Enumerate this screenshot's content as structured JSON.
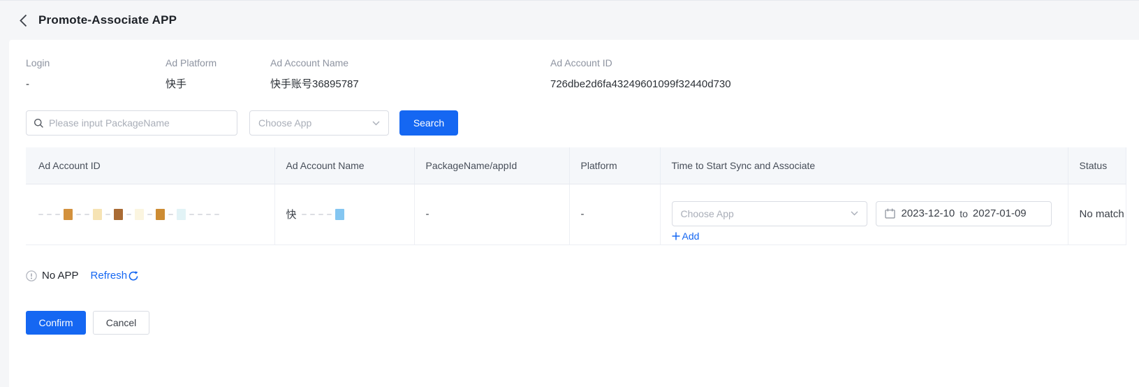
{
  "topbar": {
    "title": "Promote-Associate APP"
  },
  "info": {
    "fields": [
      {
        "label": "Login",
        "value": "-"
      },
      {
        "label": "Ad Platform",
        "value": "快手"
      },
      {
        "label": "Ad Account Name",
        "value": "快手账号36895787"
      },
      {
        "label": "Ad Account ID",
        "value": "726dbe2d6fa43249601099f32440d730"
      }
    ]
  },
  "search": {
    "package_input_placeholder": "Please input PackageName",
    "app_select_placeholder": "Choose App",
    "search_button_label": "Search"
  },
  "table": {
    "headers": [
      "Ad Account ID",
      "Ad Account Name",
      "PackageName/appId",
      "Platform",
      "Time to Start Sync and Associate",
      "Status"
    ],
    "row": {
      "account_id_redacted": {
        "b1": "background:#d3913d",
        "b2": "background:#f6e3b4",
        "b3": "background:#a96b34",
        "b4": "background:#fbf5e0",
        "b5": "background:#cd8c33",
        "b6": "background:#e2f3f6"
      },
      "account_name": {
        "visible_text": "快",
        "block": "background:#84c6f1"
      },
      "package_name": "-",
      "platform": "-",
      "app_select_placeholder": "Choose App",
      "date_start": "2023-12-10",
      "date_separator": "to",
      "date_end": "2027-01-09",
      "add_label": "Add",
      "status": "No match"
    }
  },
  "notice": {
    "message": "No APP",
    "refresh_label": "Refresh"
  },
  "actions": {
    "confirm_label": "Confirm",
    "cancel_label": "Cancel"
  },
  "colors": {
    "accent": "#1567f2",
    "table_header_bg": "#f5f7fa",
    "page_bg": "#f5f6f8"
  }
}
